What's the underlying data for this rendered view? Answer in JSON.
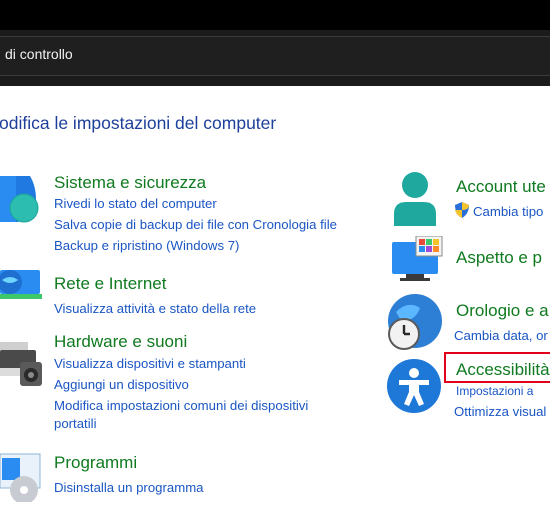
{
  "window": {
    "breadcrumb": "di controllo"
  },
  "page": {
    "title": "odifica le impostazioni del computer"
  },
  "left_categories": [
    {
      "heading": "Sistema e sicurezza",
      "icon": "shield-icon",
      "links": [
        "Rivedi lo stato del computer",
        "Salva copie di backup dei file con Cronologia file",
        "Backup e ripristino (Windows 7)"
      ]
    },
    {
      "heading": "Rete e Internet",
      "icon": "network-globe-icon",
      "links": [
        "Visualizza attività e stato della rete"
      ]
    },
    {
      "heading": "Hardware e suoni",
      "icon": "printer-speaker-icon",
      "links": [
        "Visualizza dispositivi e stampanti",
        "Aggiungi un dispositivo",
        "Modifica impostazioni comuni dei dispositivi",
        "portatili"
      ]
    },
    {
      "heading": "Programmi",
      "icon": "programs-disc-icon",
      "links": [
        "Disinstalla un programma"
      ]
    }
  ],
  "right_categories": [
    {
      "heading": "Account ute",
      "icon": "user-account-icon",
      "links": [
        "Cambia tipo"
      ],
      "link_icon": "uac-shield-icon"
    },
    {
      "heading": "Aspetto e p",
      "icon": "appearance-monitor-icon",
      "links": []
    },
    {
      "heading": "Orologio e a",
      "icon": "clock-globe-icon",
      "links": [
        "Cambia data, or"
      ]
    },
    {
      "heading": "Accessibilità",
      "icon": "accessibility-icon",
      "links": [
        "Impostazioni a",
        "Ottimizza visual"
      ],
      "highlighted": true
    }
  ],
  "colors": {
    "heading_green": "#0f7a1f",
    "link_blue": "#1a56c4",
    "title_blue": "#1e3f9a",
    "highlight_red": "#e3001b",
    "addressbar_dark": "#1b1b1b"
  }
}
